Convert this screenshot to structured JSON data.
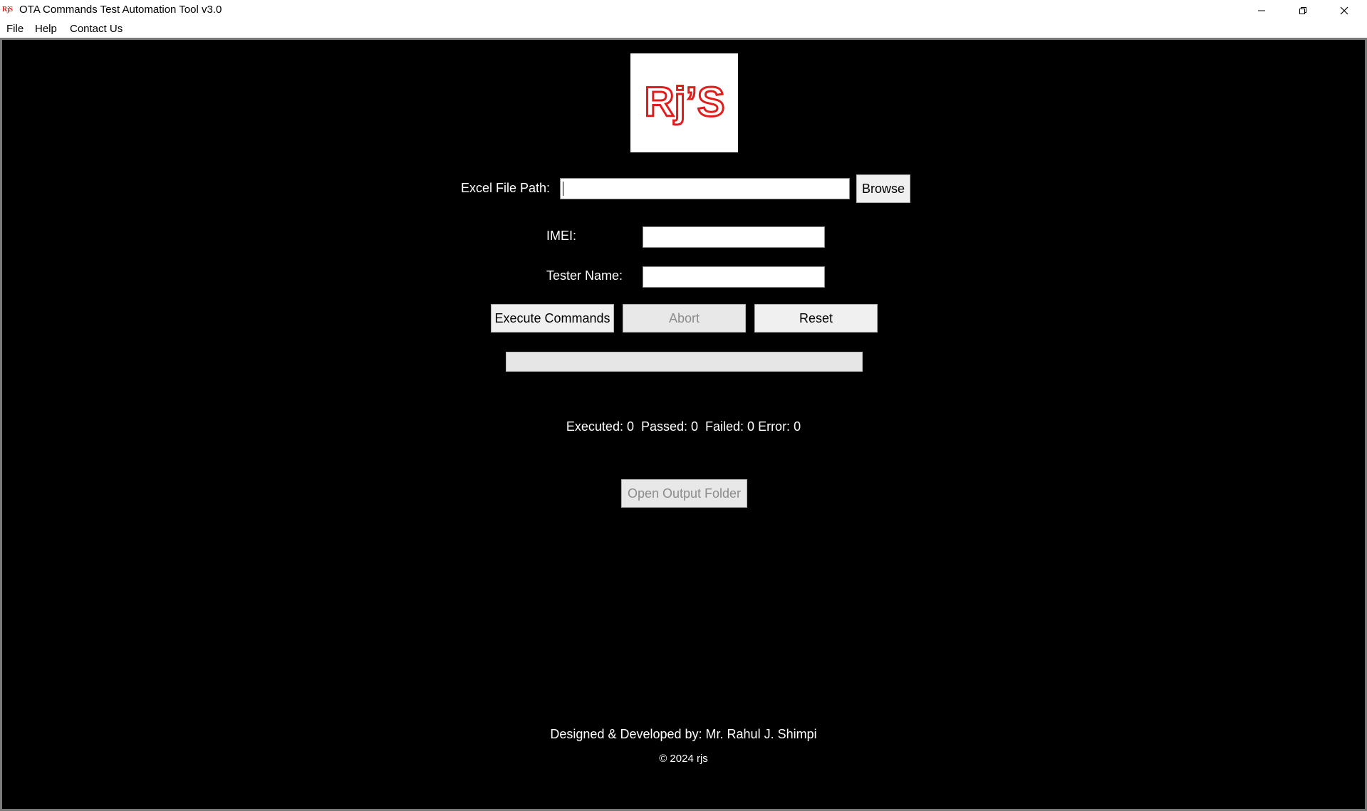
{
  "window": {
    "title": "OTA Commands Test Automation Tool v3.0",
    "icon_name": "rjs-app-icon",
    "icon_text": "RjS"
  },
  "menu": {
    "file": "File",
    "help": "Help",
    "contact": "Contact Us"
  },
  "logo": {
    "text": "Rj’S",
    "color": "#e21b1b"
  },
  "form": {
    "excel_label": "Excel File Path:",
    "excel_value": "",
    "browse_label": "Browse",
    "imei_label": "IMEI:",
    "imei_value": "",
    "tester_label": "Tester Name:",
    "tester_value": ""
  },
  "actions": {
    "execute_label": "Execute Commands",
    "abort_label": "Abort",
    "reset_label": "Reset"
  },
  "progress": {
    "value_percent": 0
  },
  "stats": {
    "text": "Executed: 0  Passed: 0  Failed: 0 Error: 0"
  },
  "output": {
    "open_folder_label": "Open Output Folder"
  },
  "footer": {
    "credit": "Designed & Developed by: Mr. Rahul J. Shimpi",
    "copyright": "© 2024 rjs"
  },
  "colors": {
    "background": "#000000",
    "text": "#ffffff",
    "button_face": "#f0f0f0",
    "disabled_text": "#8c8c8c"
  }
}
